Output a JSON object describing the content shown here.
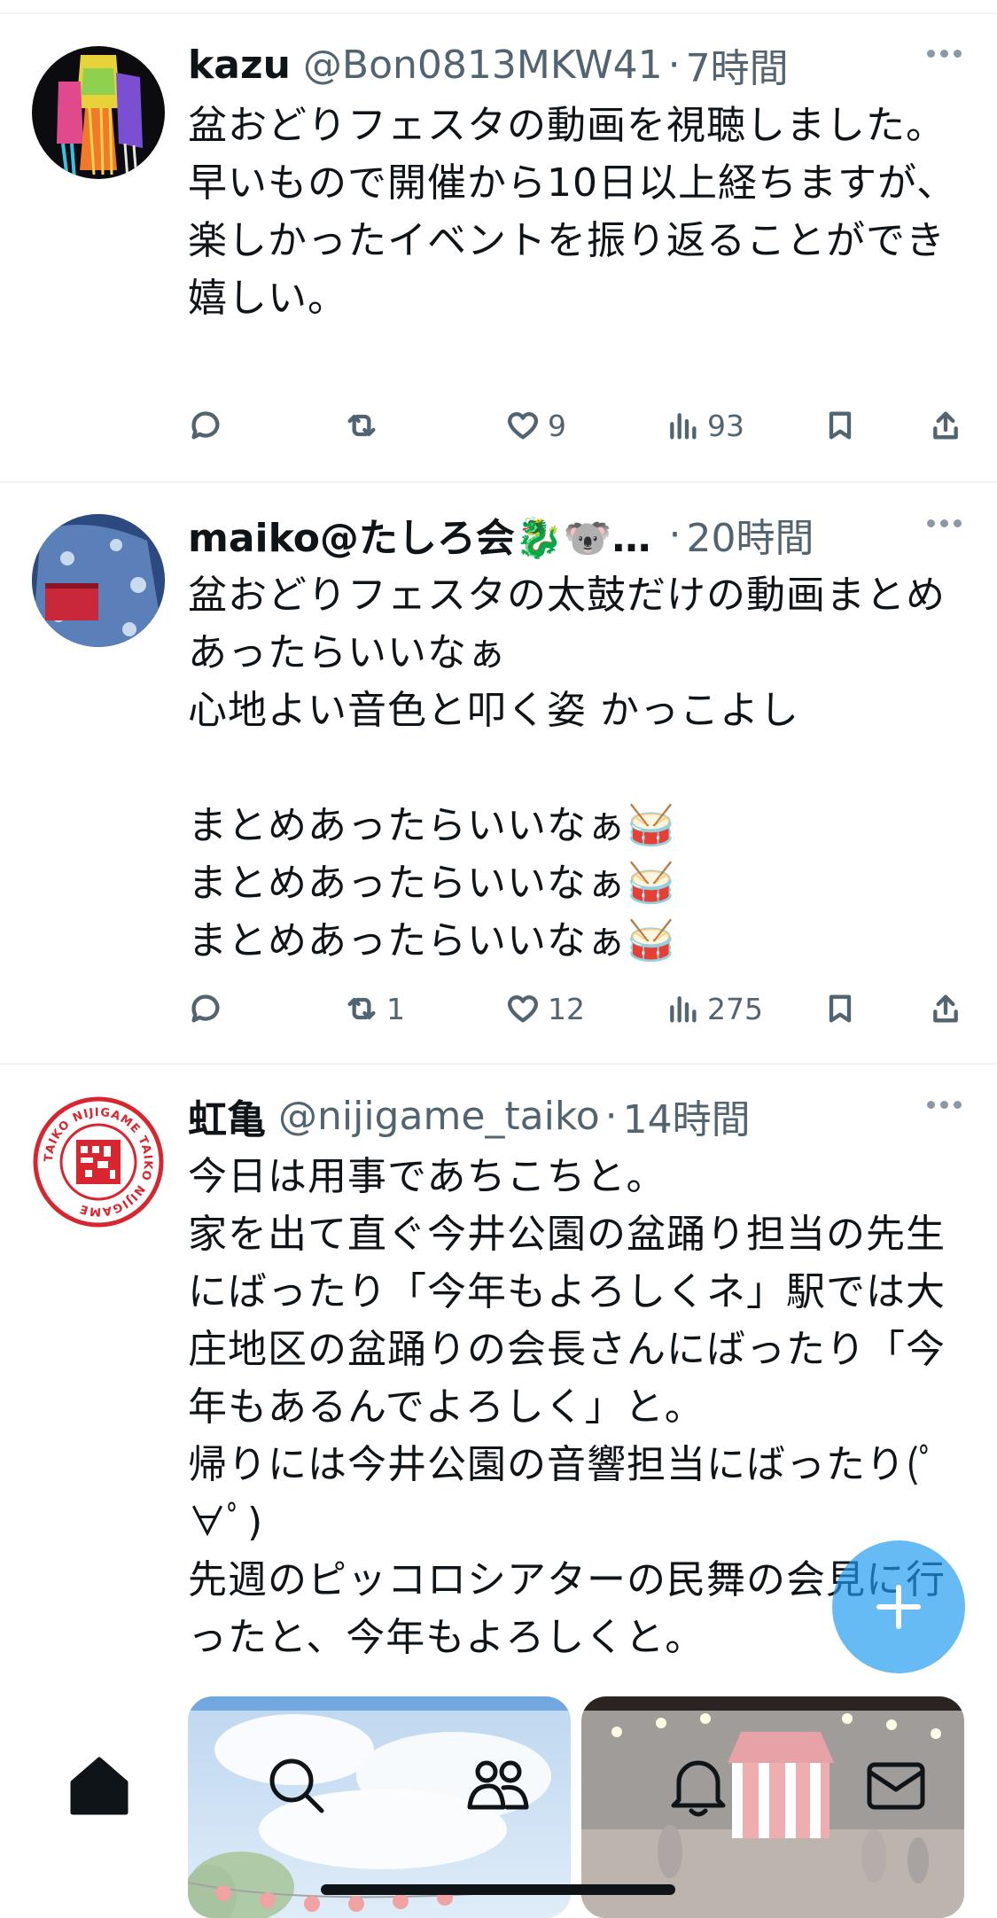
{
  "tweets": [
    {
      "name": "kazu",
      "handle": "@Bon0813MKW41",
      "time": "7時間",
      "text": "盆おどりフェスタの動画を視聴しました。\n早いもので開催から10日以上経ちますが、楽しかったイベントを振り返ることができ嬉しい。",
      "replies": "",
      "retweets": "",
      "likes": "9",
      "views": "93"
    },
    {
      "name": "maiko@たしろ会🐉🐨…",
      "handle": "",
      "time": "20時間",
      "text": "盆おどりフェスタの太鼓だけの動画まとめ あったらいいなぁ\n心地よい音色と叩く姿 かっこよし\n\nまとめあったらいいなぁ🥁\nまとめあったらいいなぁ🥁\nまとめあったらいいなぁ🥁",
      "replies": "",
      "retweets": "1",
      "likes": "12",
      "views": "275"
    },
    {
      "name": "虹亀",
      "handle": "@nijigame_taiko",
      "time": "14時間",
      "text": "今日は用事であちこちと。\n家を出て直ぐ今井公園の盆踊り担当の先生にばったり「今年もよろしくネ」駅では大庄地区の盆踊りの会長さんにばったり「今年もあるんでよろしく」と。\n帰りには今井公園の音響担当にばったり(ﾟ∀ﾟ)\n先週のピッコロシアターの民舞の会見に行ったと、今年もよろしくと。",
      "avatar_text": "TAIKO NIJIGAME TAIKO NIJIGAME"
    }
  ],
  "colors": {
    "accent": "#1d9bf0",
    "secondary_text": "#536471",
    "divider": "#eff3f4",
    "logo_red": "#d7262f"
  },
  "icons": [
    "reply-icon",
    "retweet-icon",
    "like-icon",
    "views-icon",
    "bookmark-icon",
    "share-icon",
    "more-icon",
    "compose-plus-icon",
    "home-icon",
    "search-icon",
    "communities-icon",
    "notifications-icon",
    "messages-icon"
  ]
}
